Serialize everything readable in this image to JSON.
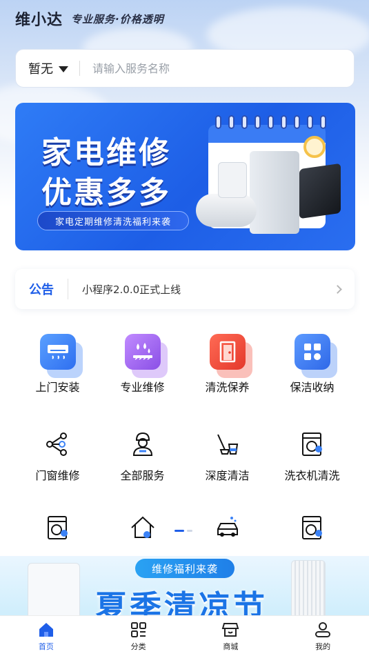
{
  "header": {
    "brand": "维小达",
    "slogan": "专业服务·价格透明"
  },
  "search": {
    "location": "暂无",
    "placeholder": "请输入服务名称"
  },
  "banner": {
    "line1": "家电维修",
    "line2": "优惠多多",
    "subtitle": "家电定期维修清洗福利来袭"
  },
  "notice": {
    "tag": "公告",
    "text": "小程序2.0.0正式上线"
  },
  "services_row1": [
    {
      "label": "上门安装",
      "icon": "air-conditioner-icon",
      "color": "#3b82f6"
    },
    {
      "label": "专业维修",
      "icon": "water-drop-icon",
      "color": "#a163f0"
    },
    {
      "label": "清洗保养",
      "icon": "door-icon",
      "color": "#f04b3a"
    },
    {
      "label": "保洁收纳",
      "icon": "grid-icon",
      "color": "#3f7ff0"
    }
  ],
  "services_row2": [
    {
      "label": "门窗维修",
      "icon": "share-nodes-icon"
    },
    {
      "label": "全部服务",
      "icon": "worker-icon"
    },
    {
      "label": "深度清洁",
      "icon": "mop-bucket-icon"
    },
    {
      "label": "洗衣机清洗",
      "icon": "washing-machine-icon"
    }
  ],
  "services_row3": [
    {
      "icon": "washing-machine-repair-icon"
    },
    {
      "icon": "house-repair-icon"
    },
    {
      "icon": "car-wash-icon"
    },
    {
      "icon": "washing-machine-repair-icon"
    }
  ],
  "promo": {
    "pill": "维修福利来袭",
    "title": "夏季清凉节"
  },
  "tabbar": [
    {
      "label": "首页",
      "icon": "home-icon",
      "active": true
    },
    {
      "label": "分类",
      "icon": "category-icon",
      "active": false
    },
    {
      "label": "商城",
      "icon": "shop-icon",
      "active": false
    },
    {
      "label": "我的",
      "icon": "user-icon",
      "active": false
    }
  ]
}
